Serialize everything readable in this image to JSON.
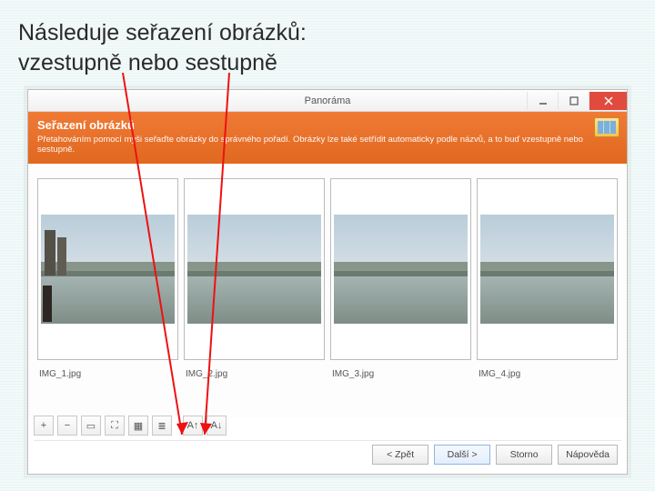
{
  "slide": {
    "title_line1": "Následuje seřazení obrázků:",
    "title_line2": "vzestupně nebo sestupně"
  },
  "window": {
    "title": "Panoráma"
  },
  "header": {
    "title": "Seřazení obrázků",
    "subtitle": "Přetahováním pomocí myši seřaďte obrázky do správného pořadí. Obrázky lze také setřídit automaticky podle názvů, a to buď vzestupně nebo sestupně."
  },
  "thumbs": [
    {
      "label": "IMG_1.jpg"
    },
    {
      "label": "IMG_2.jpg"
    },
    {
      "label": "IMG_3.jpg"
    },
    {
      "label": "IMG_4.jpg"
    }
  ],
  "toolbar": {
    "zoom_in": "+",
    "zoom_out": "−",
    "fit": "▭",
    "full": "⛶",
    "grid": "▦",
    "list": "≣",
    "sort_asc": "A↑",
    "sort_desc": "A↓"
  },
  "footer": {
    "back": "< Zpět",
    "next": "Další >",
    "cancel": "Storno",
    "help": "Nápověda"
  }
}
